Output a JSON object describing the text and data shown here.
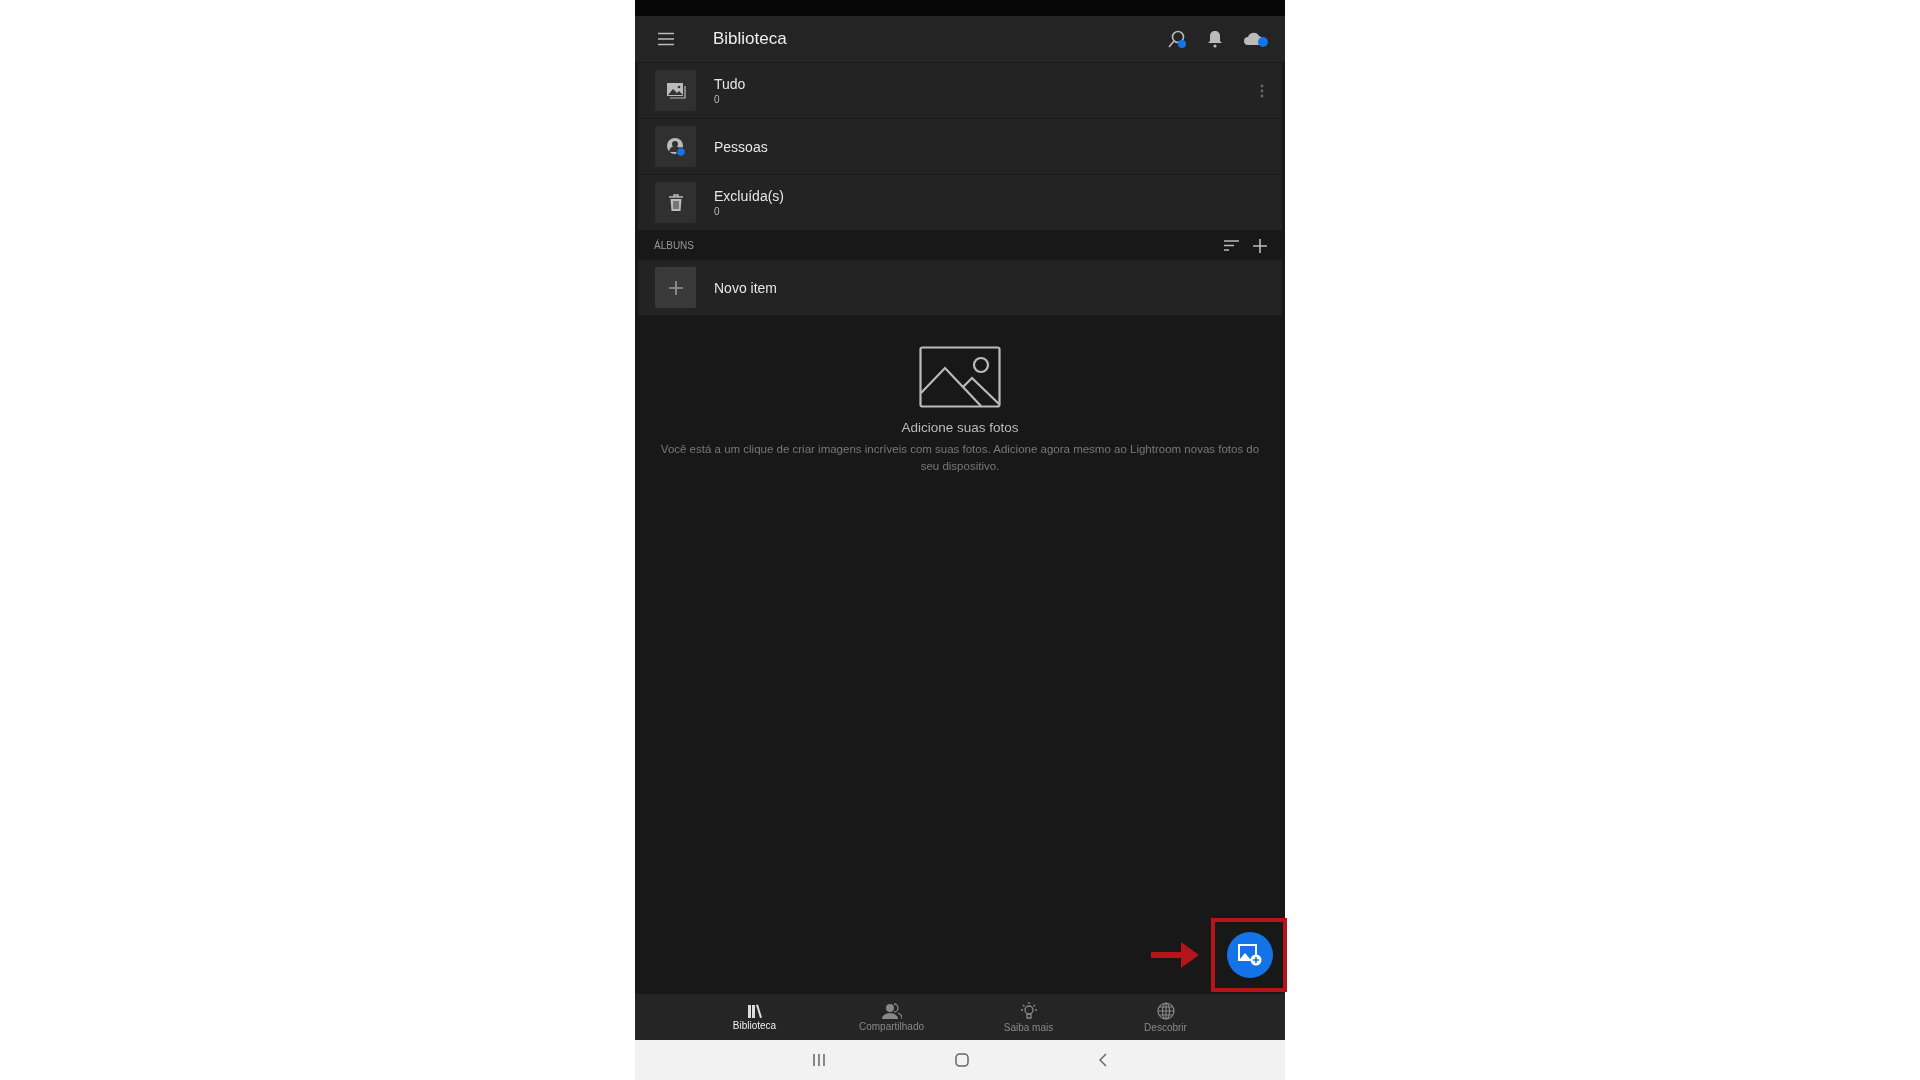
{
  "header": {
    "title": "Biblioteca"
  },
  "library_items": [
    {
      "kind": "all",
      "label": "Tudo",
      "count": "0",
      "has_menu": true
    },
    {
      "kind": "people",
      "label": "Pessoas",
      "has_menu": false
    },
    {
      "kind": "deleted",
      "label": "Excluída(s)",
      "count": "0",
      "has_menu": false
    }
  ],
  "albums": {
    "heading": "ÁLBUNS",
    "new_item": "Novo item"
  },
  "empty_state": {
    "title": "Adicione suas fotos",
    "text": "Você está a um clique de criar imagens incríveis com suas fotos. Adicione agora mesmo ao Lightroom novas fotos do seu dispositivo."
  },
  "bottom_nav": [
    {
      "kind": "library",
      "label": "Biblioteca",
      "selected": true
    },
    {
      "kind": "shared",
      "label": "Compartilhado",
      "selected": false
    },
    {
      "kind": "learn",
      "label": "Saiba mais",
      "selected": false
    },
    {
      "kind": "discover",
      "label": "Descobrir",
      "selected": false
    }
  ]
}
